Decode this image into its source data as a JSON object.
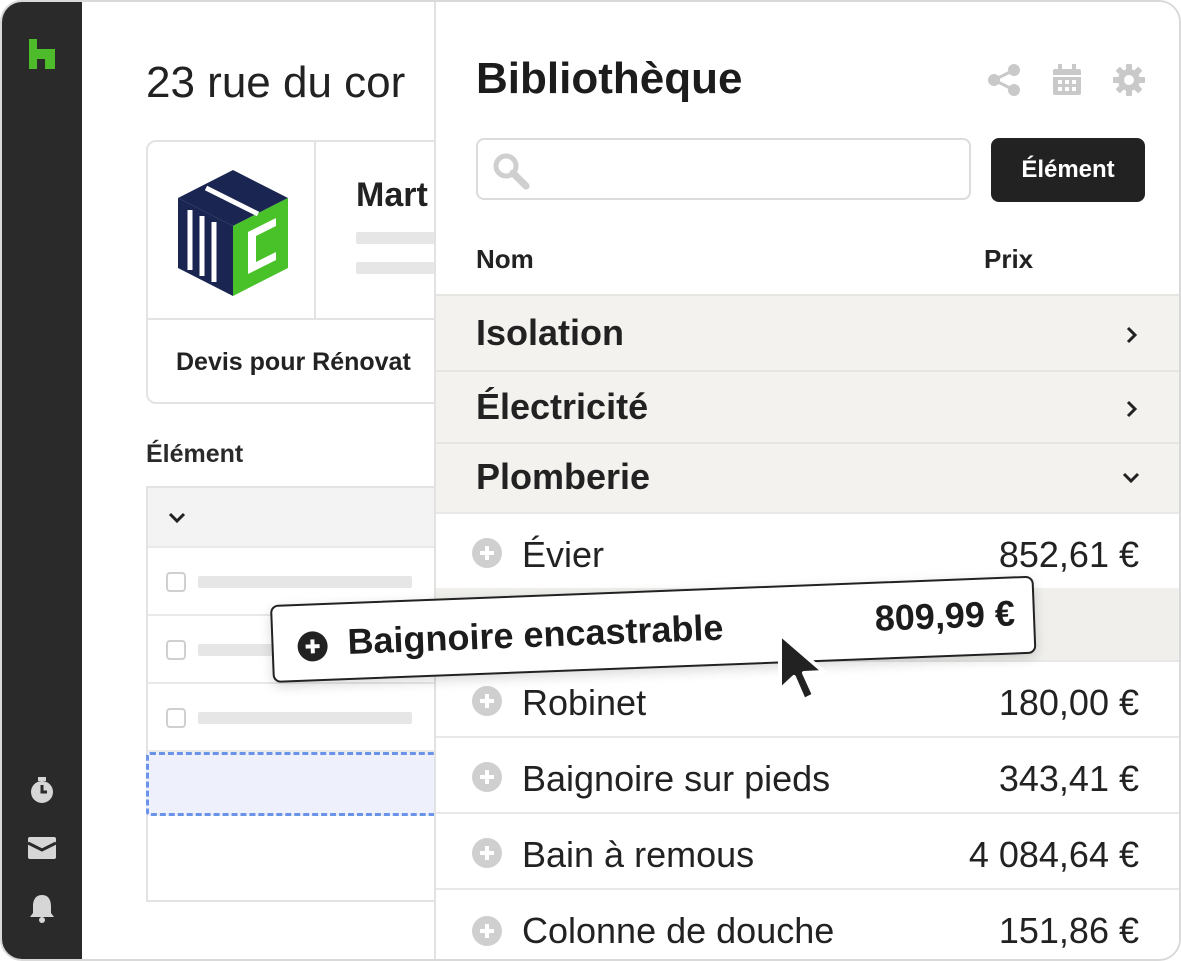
{
  "sidebar": {
    "logo_icon": "houzz-logo-icon",
    "bottom_icons": [
      "stopwatch-icon",
      "inbox-icon",
      "bell-icon"
    ],
    "accent_color": "#4dbb2a"
  },
  "document": {
    "title": "23 rue du cor",
    "company_name": "Mart",
    "subject": "Devis pour Rénovat",
    "section_label": "Élément"
  },
  "library": {
    "title": "Bibliothèque",
    "header_icons": [
      "share-icon",
      "calendar-icon",
      "gear-icon"
    ],
    "search": {
      "placeholder": "",
      "value": ""
    },
    "add_button_label": "Élément",
    "columns": {
      "name": "Nom",
      "price": "Prix"
    },
    "categories": [
      {
        "label": "Isolation",
        "state": "collapsed"
      },
      {
        "label": "Électricité",
        "state": "collapsed"
      },
      {
        "label": "Plomberie",
        "state": "expanded"
      }
    ],
    "items": [
      {
        "name": "Évier",
        "price": "852,61 €"
      },
      {
        "name": "Robinet",
        "price": "180,00 €"
      },
      {
        "name": "Baignoire sur pieds",
        "price": "343,41 €"
      },
      {
        "name": "Bain à remous",
        "price": "4 084,64 €"
      },
      {
        "name": "Colonne de douche",
        "price": "151,86 €"
      }
    ]
  },
  "dragged_item": {
    "name": "Baignoire encastrable",
    "price": "809,99 €"
  },
  "colors": {
    "sidebar": "#2a2a2a",
    "drop_zone_border": "#6b93e8",
    "button": "#222222"
  }
}
